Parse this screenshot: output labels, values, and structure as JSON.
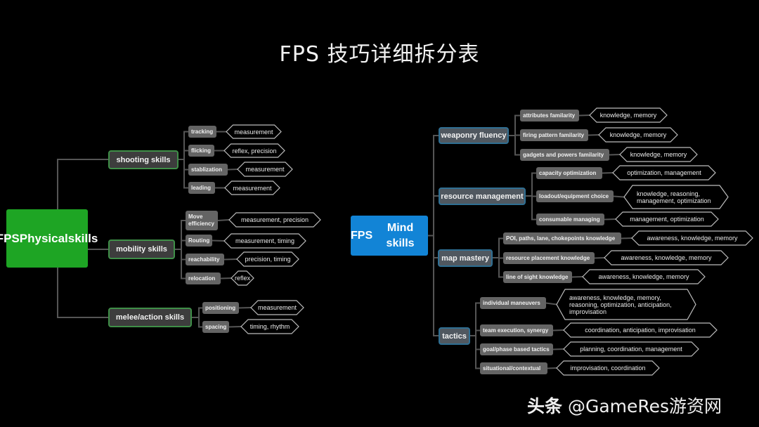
{
  "title": "FPS 技巧详细拆分表",
  "watermark": {
    "brand": "头条",
    "handle": "@GameRes游资网"
  },
  "colors": {
    "background": "#000000",
    "physical_root": "#1ea524",
    "mind_root": "#1284d6",
    "physical_branch_border": "#3f8f48",
    "mind_branch_border": "#2f6f93",
    "leaf_fill": "#646464",
    "connector": "#555555",
    "hex_border": "#bdbdbd"
  },
  "physical": {
    "root": {
      "line1": "FPS",
      "line2": "Physical",
      "line3": "skills"
    },
    "branches": [
      {
        "label": "shooting skills",
        "leaves": [
          {
            "label": "tracking",
            "attrs": "measurement"
          },
          {
            "label": "flicking",
            "attrs": "reflex, precision"
          },
          {
            "label": "stablization",
            "attrs": "measurement"
          },
          {
            "label": "leading",
            "attrs": "measurement"
          }
        ]
      },
      {
        "label": "mobility skills",
        "leaves": [
          {
            "label": "Move efficiency",
            "attrs": "measurement, precision"
          },
          {
            "label": "Routing",
            "attrs": "measurement, timing"
          },
          {
            "label": "reachability",
            "attrs": "precision, timing"
          },
          {
            "label": "relocation",
            "attrs": "reflex"
          }
        ]
      },
      {
        "label": "melee/action skills",
        "leaves": [
          {
            "label": "positioning",
            "attrs": "measurement"
          },
          {
            "label": "spacing",
            "attrs": "timing, rhythm"
          }
        ]
      }
    ]
  },
  "mind": {
    "root": {
      "line1": "FPS",
      "line2": "Mind skills"
    },
    "branches": [
      {
        "label": "weaponry fluency",
        "leaves": [
          {
            "label": "attributes familarity",
            "attrs": "knowledge, memory"
          },
          {
            "label": "firing pattern familarity",
            "attrs": "knowledge, memory"
          },
          {
            "label": "gadgets and powers familarity",
            "attrs": "knowledge, memory"
          }
        ]
      },
      {
        "label": "resource management",
        "leaves": [
          {
            "label": "capacity optimization",
            "attrs": "optimization, management"
          },
          {
            "label": "loadout/equipment choice",
            "attrs": "knowledge, reasoning, management, optimization"
          },
          {
            "label": "consumable managing",
            "attrs": "management, optimization"
          }
        ]
      },
      {
        "label": "map mastery",
        "leaves": [
          {
            "label": "POI, paths, lane, chokepoints knowledge",
            "attrs": "awareness, knowledge, memory"
          },
          {
            "label": "resource placement knowledge",
            "attrs": "awareness, knowledge, memory"
          },
          {
            "label": "line of sight knowledge",
            "attrs": "awareness, knowledge, memory"
          }
        ]
      },
      {
        "label": "tactics",
        "leaves": [
          {
            "label": "individual maneuvers",
            "attrs": "awareness, knowledge, memory, reasoning, optimization, anticipation, improvisation"
          },
          {
            "label": "team execution, synergy",
            "attrs": "coordination, anticipation, improvisation"
          },
          {
            "label": "goal/phase based tactics",
            "attrs": "planning, coordination, management"
          },
          {
            "label": "situational/contextual",
            "attrs": "improvisation, coordination"
          }
        ]
      }
    ]
  }
}
